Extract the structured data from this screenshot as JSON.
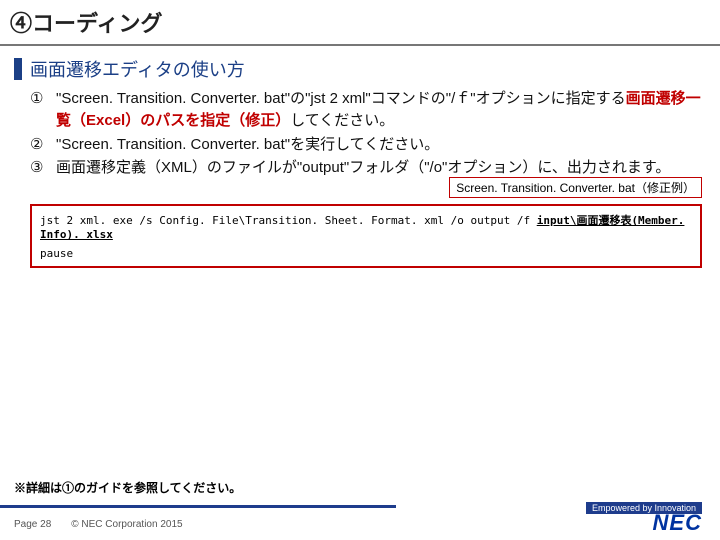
{
  "title": "④コーディング",
  "subtitle": "画面遷移エディタの使い方",
  "items": [
    {
      "num": "①",
      "pre": "\"Screen. Transition. Converter. bat\"の\"jst 2 xml\"コマンドの\"/ｆ\"オプションに指定する",
      "highlight": "画面遷移一覧（Excel）のパスを指定（修正）",
      "post": "してください。"
    },
    {
      "num": "②",
      "pre": "\"Screen. Transition. Converter. bat\"を実行してください。",
      "highlight": "",
      "post": ""
    },
    {
      "num": "③",
      "pre": "画面遷移定義（XML）のファイルが\"output\"フォルダ（\"/o\"オプション）に、出力されます。",
      "highlight": "",
      "post": ""
    }
  ],
  "bat_label": "Screen. Transition. Converter. bat（修正例）",
  "code": {
    "line1_pre": "jst 2 xml. exe /s Config. File\\Transition. Sheet. Format. xml /o output /f ",
    "line1_ul": "input\\画面遷移表(Member. Info). xlsx",
    "line2": "pause"
  },
  "note": "※詳細は①のガイドを参照してください。",
  "footer": {
    "page": "Page 28",
    "copyright": "© NEC Corporation 2015"
  },
  "tagline": "Empowered by Innovation",
  "logo": "NEC"
}
